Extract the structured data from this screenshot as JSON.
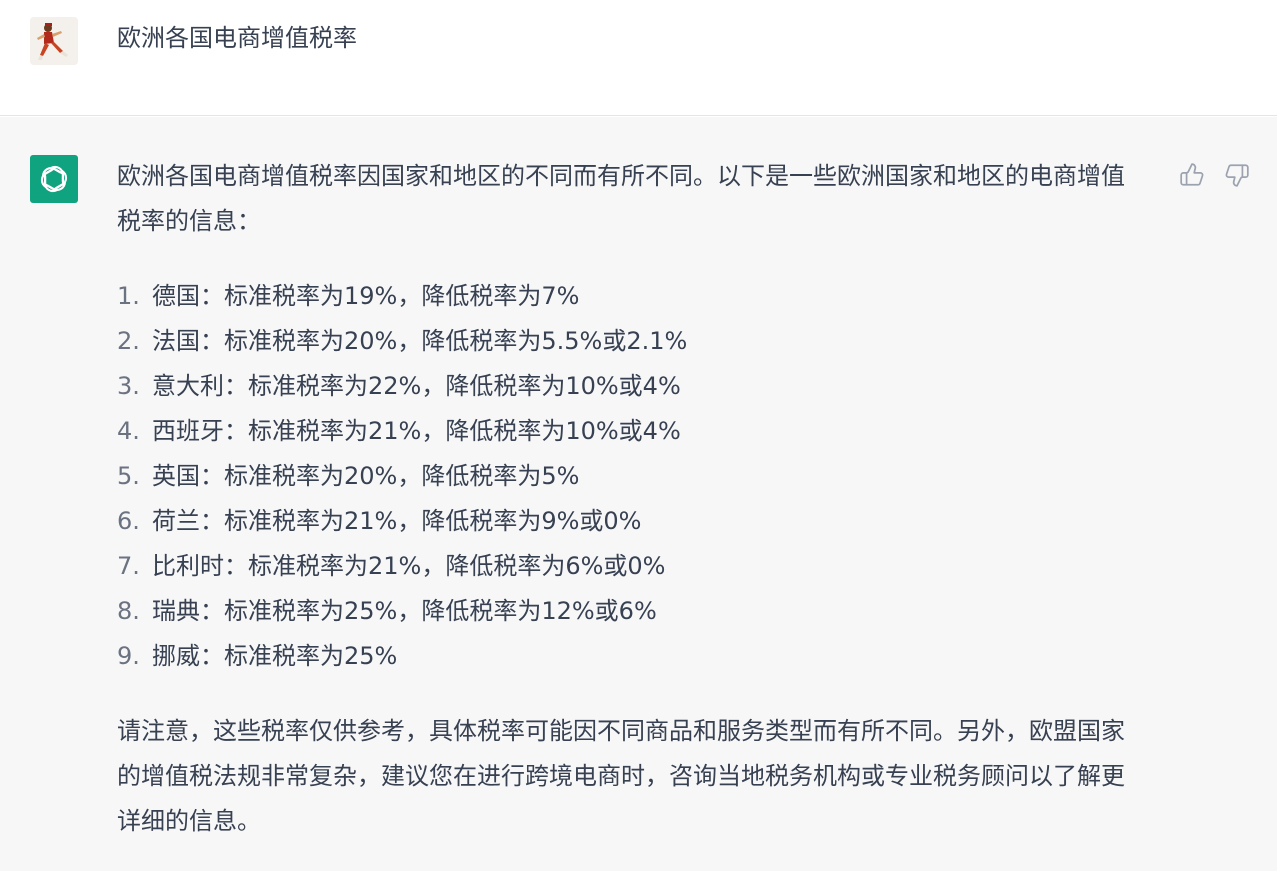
{
  "user_message": {
    "text": "欧洲各国电商增值税率"
  },
  "assistant_message": {
    "intro": "欧洲各国电商增值税率因国家和地区的不同而有所不同。以下是一些欧洲国家和地区的电商增值税率的信息：",
    "items": [
      {
        "num": "1.",
        "text": "德国：标准税率为19%，降低税率为7%"
      },
      {
        "num": "2.",
        "text": "法国：标准税率为20%，降低税率为5.5%或2.1%"
      },
      {
        "num": "3.",
        "text": "意大利：标准税率为22%，降低税率为10%或4%"
      },
      {
        "num": "4.",
        "text": "西班牙：标准税率为21%，降低税率为10%或4%"
      },
      {
        "num": "5.",
        "text": "英国：标准税率为20%，降低税率为5%"
      },
      {
        "num": "6.",
        "text": "荷兰：标准税率为21%，降低税率为9%或0%"
      },
      {
        "num": "7.",
        "text": "比利时：标准税率为21%，降低税率为6%或0%"
      },
      {
        "num": "8.",
        "text": "瑞典：标准税率为25%，降低税率为12%或6%"
      },
      {
        "num": "9.",
        "text": "挪威：标准税率为25%"
      }
    ],
    "outro": "请注意，这些税率仅供参考，具体税率可能因不同商品和服务类型而有所不同。另外，欧盟国家的增值税法规非常复杂，建议您在进行跨境电商时，咨询当地税务机构或专业税务顾问以了解更详细的信息。"
  },
  "icons": {
    "assistant_avatar": "openai-logo-icon",
    "feedback_up": "thumbs-up-icon",
    "feedback_down": "thumbs-down-icon"
  },
  "colors": {
    "assistant_avatar_bg": "#10a37f",
    "assistant_row_bg": "#f7f7f8",
    "text": "#374151"
  }
}
